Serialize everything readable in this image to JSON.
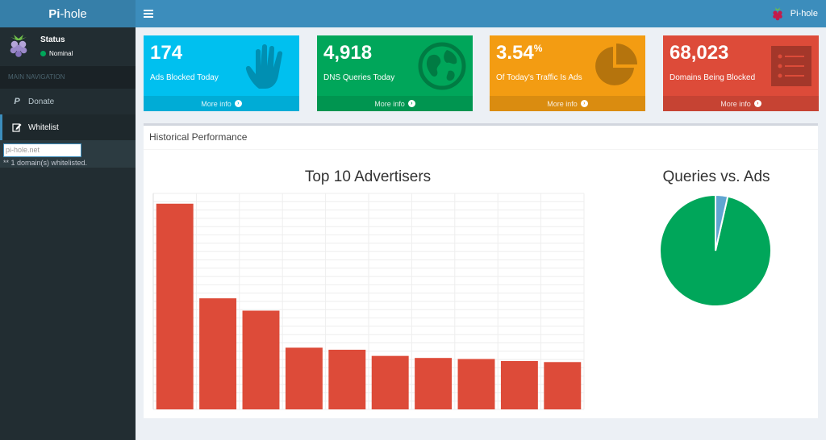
{
  "brand": {
    "bold": "Pi",
    "rest": "-hole"
  },
  "topbar": {
    "user_label": "Pi-hole"
  },
  "sidebar": {
    "status_title": "Status",
    "status_text": "Nominal",
    "nav_header": "MAIN NAVIGATION",
    "items": [
      {
        "icon": "paypal-icon",
        "label": "Donate"
      },
      {
        "icon": "edit-icon",
        "label": "Whitelist"
      }
    ],
    "whitelist_input_value": "pi-hole.net",
    "whitelist_note": "** 1 domain(s) whitelisted."
  },
  "stats": [
    {
      "value": "174",
      "sup": "",
      "label": "Ads Blocked Today",
      "footer": "More info",
      "color": "#00c0ef",
      "icon": "hand-icon"
    },
    {
      "value": "4,918",
      "sup": "",
      "label": "DNS Queries Today",
      "footer": "More info",
      "color": "#00a65a",
      "icon": "globe-icon"
    },
    {
      "value": "3.54",
      "sup": "%",
      "label": "Of Today's Traffic Is Ads",
      "footer": "More info",
      "color": "#f39c12",
      "icon": "pie-chart-icon"
    },
    {
      "value": "68,023",
      "sup": "",
      "label": "Domains Being Blocked",
      "footer": "More info",
      "color": "#dd4b39",
      "icon": "list-icon"
    }
  ],
  "panel": {
    "title": "Historical Performance"
  },
  "chart_data": [
    {
      "type": "bar",
      "title": "Top 10 Advertisers",
      "values": [
        100,
        54,
        48,
        30,
        29,
        26,
        25,
        24.5,
        23.5,
        23
      ],
      "ylim": [
        0,
        105
      ],
      "grid": true,
      "color": "#dd4b39"
    },
    {
      "type": "pie",
      "title": "Queries vs. Ads",
      "values": [
        96.46,
        3.54
      ],
      "colors": [
        "#00a65a",
        "#60a5d1"
      ]
    }
  ]
}
